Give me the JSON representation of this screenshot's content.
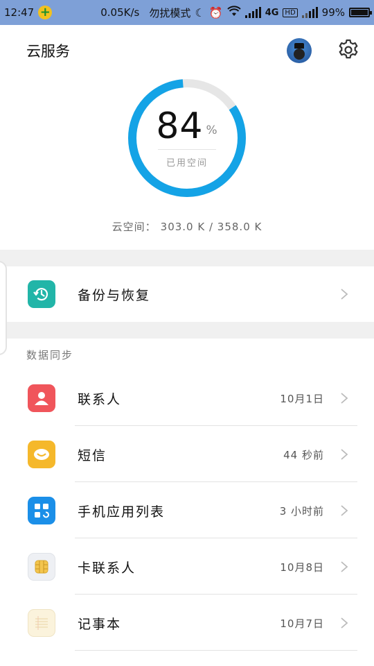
{
  "status_bar": {
    "time": "12:47",
    "speed": "0.05K/s",
    "mode": "勿扰模式",
    "network": "4G",
    "hd": "HD",
    "battery": "99%"
  },
  "header": {
    "title": "云服务"
  },
  "usage": {
    "percent": "84",
    "percent_unit": "%",
    "percent_value": 0.84,
    "label": "已用空间",
    "storage_label": "云空间：",
    "storage_value": "303.0 K / 358.0 K"
  },
  "colors": {
    "accent": "#14a3e6",
    "ring_track": "#e6e6e6",
    "status_bar": "#7ea0d7"
  },
  "backup": {
    "label": "备份与恢复",
    "icon": "backup-clock-icon"
  },
  "sync": {
    "section_title": "数据同步",
    "items": [
      {
        "label": "联系人",
        "time": "10月1日",
        "icon": "contacts-icon"
      },
      {
        "label": "短信",
        "time": "44 秒前",
        "icon": "messages-icon"
      },
      {
        "label": "手机应用列表",
        "time": "3 小时前",
        "icon": "app-list-icon"
      },
      {
        "label": "卡联系人",
        "time": "10月8日",
        "icon": "sim-card-icon"
      },
      {
        "label": "记事本",
        "time": "10月7日",
        "icon": "notepad-icon"
      }
    ]
  }
}
